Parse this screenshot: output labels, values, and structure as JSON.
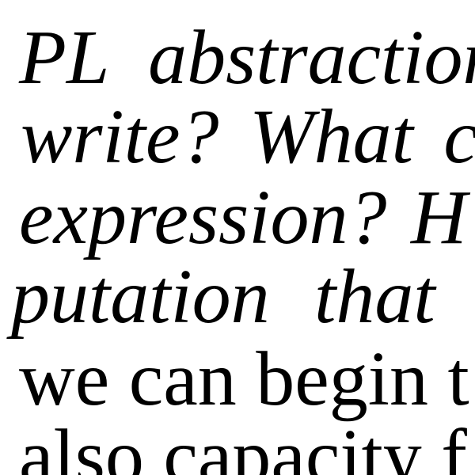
{
  "document": {
    "lines": [
      "PL abstraction",
      "write? What c",
      "expression? H",
      "putation that p",
      "we can begin t",
      "also capacity f"
    ]
  }
}
